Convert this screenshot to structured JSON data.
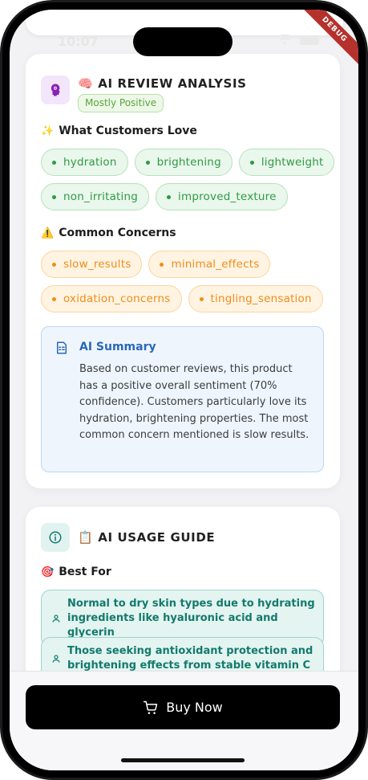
{
  "status_bar": {
    "time": "10:07",
    "debug_label": "DEBUG"
  },
  "review": {
    "emoji": "🧠",
    "title": "AI REVIEW ANALYSIS",
    "sentiment": "Mostly Positive",
    "love_emoji": "✨",
    "love_label": "What Customers Love",
    "love_row1": [
      "hydration",
      "brightening",
      "lightweight"
    ],
    "love_row2": [
      "non_irritating",
      "improved_texture"
    ],
    "concern_emoji": "⚠️",
    "concern_label": "Common Concerns",
    "concern_row1": [
      "slow_results",
      "minimal_effects"
    ],
    "concern_row2": [
      "oxidation_concerns",
      "tingling_sensation"
    ],
    "summary_title": "AI Summary",
    "summary_text": "Based on customer reviews, this product has a positive overall sentiment (70% confidence). Customers particularly love its hydration, brightening properties. The most common concern mentioned is slow results."
  },
  "usage": {
    "emoji": "📋",
    "title": "AI USAGE GUIDE",
    "best_emoji": "🎯",
    "best_label": "Best For",
    "items": [
      "Normal to dry skin types due to hydrating ingredients like hyaluronic acid and glycerin",
      "Those seeking antioxidant protection and brightening effects from stable vitamin C"
    ]
  },
  "bottom": {
    "buy_label": "Buy Now"
  },
  "colors": {
    "love_chip": "#2e9b43",
    "concern_chip": "#f08c1a",
    "summary_accent": "#2b67b8",
    "guide_accent": "#137a6c",
    "buy_button": "#000000"
  },
  "icons": {
    "review": "brain-head-icon",
    "usage": "info-icon",
    "summary": "document-icon",
    "guide_item": "person-icon",
    "buy": "cart-icon"
  }
}
